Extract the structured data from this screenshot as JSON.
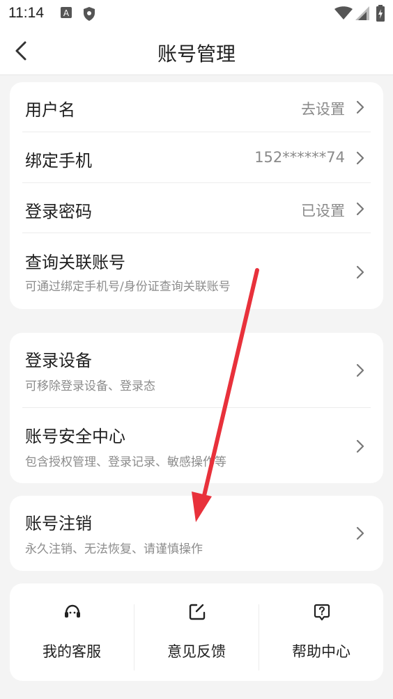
{
  "status": {
    "time": "11:14"
  },
  "header": {
    "title": "账号管理"
  },
  "section1": {
    "username": {
      "label": "用户名",
      "value": "去设置"
    },
    "phone": {
      "label": "绑定手机",
      "value": "152******74"
    },
    "password": {
      "label": "登录密码",
      "value": "已设置"
    },
    "linked": {
      "label": "查询关联账号",
      "desc": "可通过绑定手机号/身份证查询关联账号"
    }
  },
  "section2": {
    "devices": {
      "label": "登录设备",
      "desc": "可移除登录设备、登录态"
    },
    "security": {
      "label": "账号安全中心",
      "desc": "包含授权管理、登录记录、敏感操作等"
    }
  },
  "section3": {
    "cancel": {
      "label": "账号注销",
      "desc": "永久注销、无法恢复、请谨慎操作"
    }
  },
  "footer": {
    "service": "我的客服",
    "feedback": "意见反馈",
    "help": "帮助中心"
  },
  "colors": {
    "accent_arrow": "#e8313b",
    "background": "#f4f4f4",
    "card": "#ffffff"
  }
}
